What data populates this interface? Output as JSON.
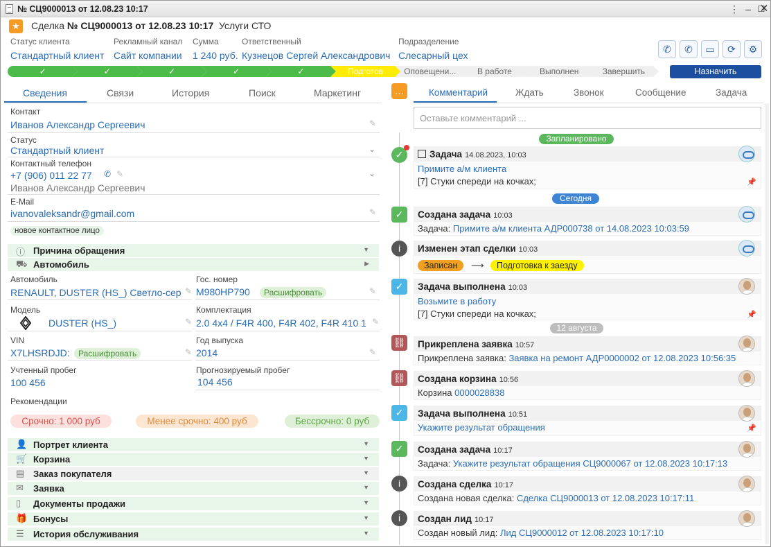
{
  "window": {
    "title": "№ СЦ9000013 от 12.08.23 10:17"
  },
  "header": {
    "prefix": "Сделка",
    "number": "№ СЦ9000013 от 12.08.23 10:17",
    "type": "Услуги СТО"
  },
  "fields": [
    {
      "label": "Статус клиента",
      "value": "Стандартный клиент"
    },
    {
      "label": "Рекламный канал",
      "value": "Сайт компании"
    },
    {
      "label": "Сумма",
      "value": "1 240 руб."
    },
    {
      "label": "Ответственный",
      "value": "Кузнецов Сергей Александрович"
    },
    {
      "label": "Подразделение",
      "value": "Слесарный цех"
    }
  ],
  "stages": [
    {
      "label": "✓",
      "state": "done"
    },
    {
      "label": "✓",
      "state": "done"
    },
    {
      "label": "✓",
      "state": "done"
    },
    {
      "label": "✓",
      "state": "done"
    },
    {
      "label": "✓",
      "state": "done"
    },
    {
      "label": "Подготов",
      "state": "current"
    },
    {
      "label": "Оповещени...",
      "state": "todo"
    },
    {
      "label": "В работе",
      "state": "todo"
    },
    {
      "label": "Выполнен",
      "state": "todo"
    },
    {
      "label": "Завершить",
      "state": "todo"
    }
  ],
  "assign_label": "Назначить",
  "left_tabs": [
    "Сведения",
    "Связи",
    "История",
    "Поиск",
    "Маркетинг"
  ],
  "contact": {
    "label": "Контакт",
    "value": "Иванов Александр Сергеевич"
  },
  "status": {
    "label": "Статус",
    "value": "Стандартный клиент"
  },
  "phone": {
    "label": "Контактный телефон",
    "value": "+7 (906) 011 22 77",
    "owner": "Иванов Александр Сергеевич"
  },
  "email": {
    "label": "E-Mail",
    "value": "ivanovaleksandr@gmail.com"
  },
  "new_contact_tag": "новое контактное лицо",
  "sections_top": [
    {
      "label": "Причина обращения"
    },
    {
      "label": "Автомобиль"
    }
  ],
  "car": {
    "auto_label": "Автомобиль",
    "auto_value": "RENAULT, DUSTER (HS_) Светло-сер",
    "plate_label": "Гос. номер",
    "plate_value": "М980НР790",
    "decode": "Расшифровать",
    "model_label": "Модель",
    "model_value": "DUSTER (HS_)",
    "kit_label": "Комплектация",
    "kit_value": "2.0 4x4 / F4R 400, F4R 402, F4R 410 1",
    "vin_label": "VIN",
    "vin_value": "X7LHSRDJD:",
    "year_label": "Год выпуска",
    "year_value": "2014",
    "mileage_label": "Учтенный пробег",
    "mileage_value": "100 456",
    "forecast_label": "Прогнозируемый пробег",
    "forecast_value": "104 456"
  },
  "recommendations": {
    "label": "Рекомендации",
    "urgent": "Срочно: 1 000 руб",
    "less": "Менее срочно: 400 руб",
    "none": "Бессрочно: 0 руб"
  },
  "sections_bottom": [
    {
      "label": "Портрет клиента"
    },
    {
      "label": "Корзина"
    },
    {
      "label": "Заказ покупателя"
    },
    {
      "label": "Заявка"
    },
    {
      "label": "Документы продажи"
    },
    {
      "label": "Бонусы"
    },
    {
      "label": "История обслуживания"
    }
  ],
  "right_tabs": [
    "Комментарий",
    "Ждать",
    "Звонок",
    "Сообщение",
    "Задача"
  ],
  "comment_placeholder": "Оставьте комментарий ...",
  "pills": {
    "planned": "Запланировано",
    "today": "Сегодня",
    "date": "12 августа"
  },
  "events": [
    {
      "title": "Задача",
      "time": "14.08.2023, 10:03",
      "l1": "Примите а/м клиента",
      "l2": "[7] Стуки спереди на кочках;"
    },
    {
      "title": "Создана задача",
      "time": "10:03",
      "prefix": "Задача:",
      "link": "Примите а/м клиента АДР000738 от 14.08.2023 10:03:59"
    },
    {
      "title": "Изменен этап сделки",
      "time": "10:03",
      "from": "Записан",
      "arrow": "⟶",
      "to": "Подготовка к заезду"
    },
    {
      "title": "Задача выполнена",
      "time": "10:03",
      "l1": "Возьмите в работу",
      "l2": "[7] Стуки спереди на кочках;"
    },
    {
      "title": "Прикреплена заявка",
      "time": "10:57",
      "prefix": "Прикреплена заявка:",
      "link": "Заявка на ремонт АДР0000002 от 12.08.2023 10:56:35"
    },
    {
      "title": "Создана корзина",
      "time": "10:56",
      "prefix": "Корзина",
      "link": "0000028838"
    },
    {
      "title": "Задача выполнена",
      "time": "10:51",
      "l1": "Укажите результат обращения"
    },
    {
      "title": "Создана задача",
      "time": "10:17",
      "prefix": "Задача:",
      "link": "Укажите результат обращения СЦ9000067 от 12.08.2023 10:17:13"
    },
    {
      "title": "Создана сделка",
      "time": "10:17",
      "prefix": "Создана новая сделка:",
      "link": "Сделка СЦ9000013 от 12.08.2023 10:17:11"
    },
    {
      "title": "Создан лид",
      "time": "10:17",
      "prefix": "Создан новый лид:",
      "link": "Лид СЦ9000012 от 12.08.2023 10:17:10"
    }
  ]
}
